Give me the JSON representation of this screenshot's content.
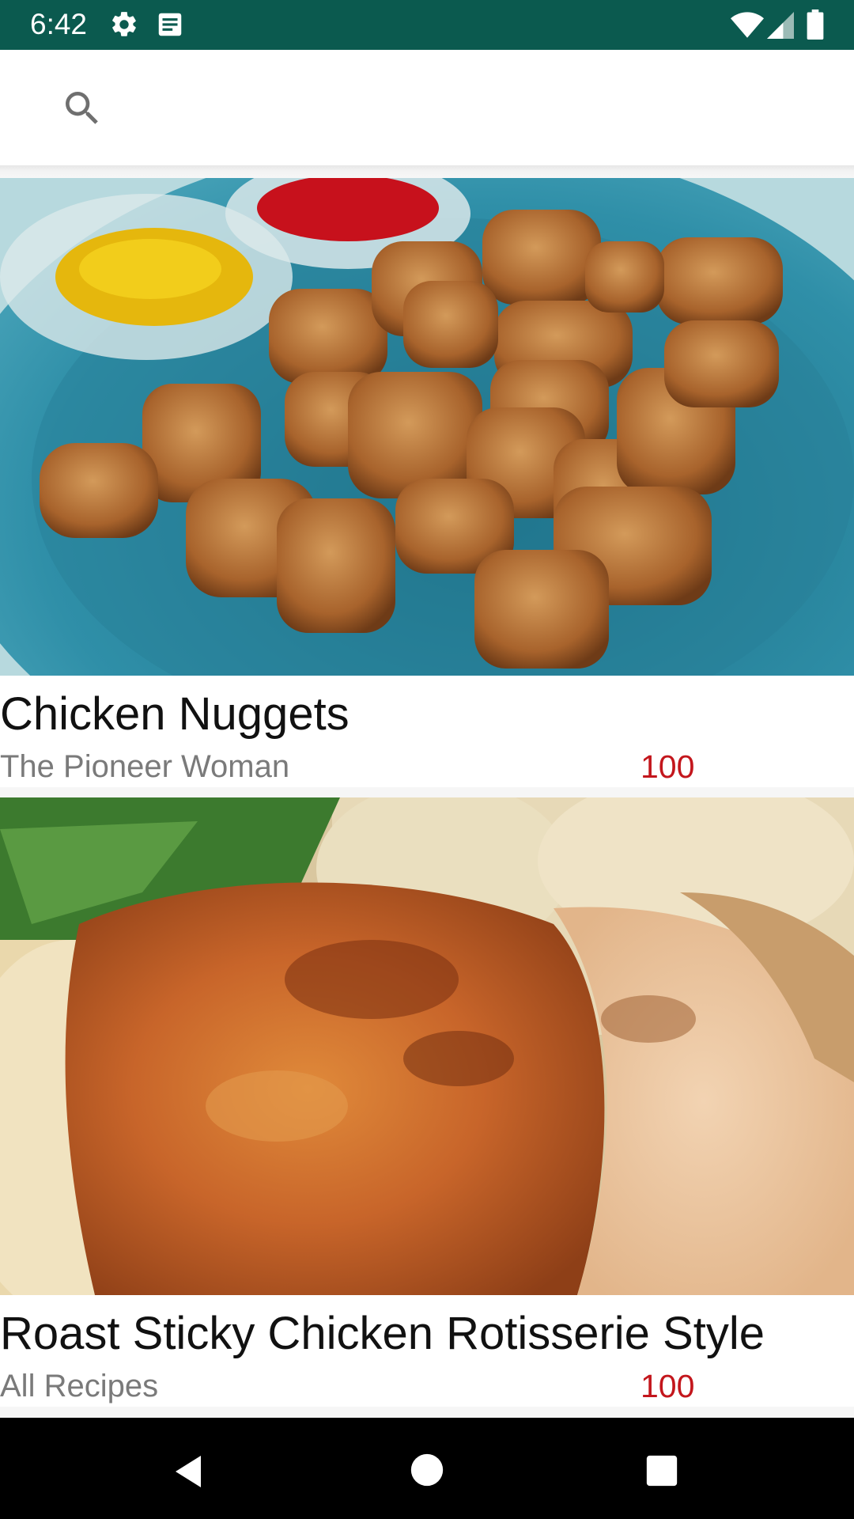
{
  "status_bar": {
    "time": "6:42",
    "icons": [
      "gear-icon",
      "notification-message-icon",
      "wifi-icon",
      "signal-icon",
      "battery-icon"
    ],
    "background": "#0b5a4f"
  },
  "search": {
    "placeholder": "",
    "value": ""
  },
  "recipes": [
    {
      "title": "Chicken Nuggets",
      "source": "The Pioneer Woman",
      "score": "100",
      "image": "chicken-nuggets-photo"
    },
    {
      "title": "Roast Sticky Chicken Rotisserie Style",
      "source": "All Recipes",
      "score": "100",
      "image": "roast-chicken-photo"
    }
  ],
  "colors": {
    "score": "#c3161c",
    "source": "#7a7a7a",
    "title": "#111111"
  },
  "nav_bar": {
    "buttons": [
      "back-icon",
      "home-icon",
      "recents-icon"
    ]
  }
}
